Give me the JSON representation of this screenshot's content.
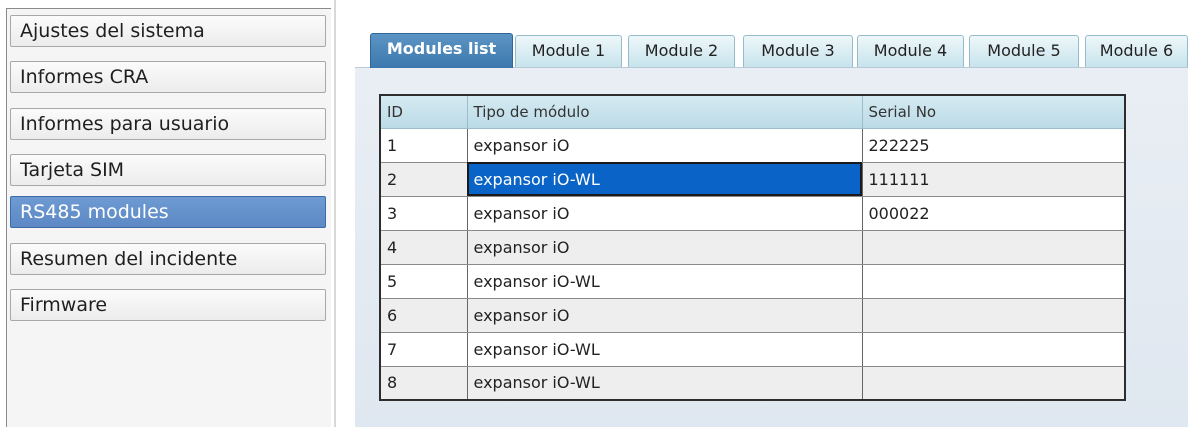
{
  "sidebar": {
    "items": [
      {
        "label": "Ajustes del sistema"
      },
      {
        "label": "Informes CRA"
      },
      {
        "label": "Informes para usuario"
      },
      {
        "label": "Tarjeta SIM"
      },
      {
        "label": "RS485 modules",
        "selected": true
      },
      {
        "label": "Resumen del incidente"
      },
      {
        "label": "Firmware"
      }
    ]
  },
  "tabs": [
    {
      "label": "Modules list",
      "active": true
    },
    {
      "label": "Module 1"
    },
    {
      "label": "Module 2"
    },
    {
      "label": "Module 3"
    },
    {
      "label": "Module 4"
    },
    {
      "label": "Module 5"
    },
    {
      "label": "Module 6"
    }
  ],
  "table": {
    "headers": [
      "ID",
      "Tipo de módulo",
      "Serial No"
    ],
    "rows": [
      {
        "id": "1",
        "type": "expansor iO",
        "serial": "222225"
      },
      {
        "id": "2",
        "type": "expansor iO-WL",
        "serial": "111111",
        "selected_cell": "type"
      },
      {
        "id": "3",
        "type": "expansor iO",
        "serial": "000022"
      },
      {
        "id": "4",
        "type": "expansor iO",
        "serial": ""
      },
      {
        "id": "5",
        "type": "expansor iO-WL",
        "serial": ""
      },
      {
        "id": "6",
        "type": "expansor iO",
        "serial": ""
      },
      {
        "id": "7",
        "type": "expansor iO-WL",
        "serial": ""
      },
      {
        "id": "8",
        "type": "expansor iO-WL",
        "serial": ""
      }
    ]
  },
  "colors": {
    "selected_nav": "#5c88c4",
    "active_tab": "#3c78ae",
    "selected_cell": "#0a64c8",
    "table_header": "#bbdbe7"
  }
}
